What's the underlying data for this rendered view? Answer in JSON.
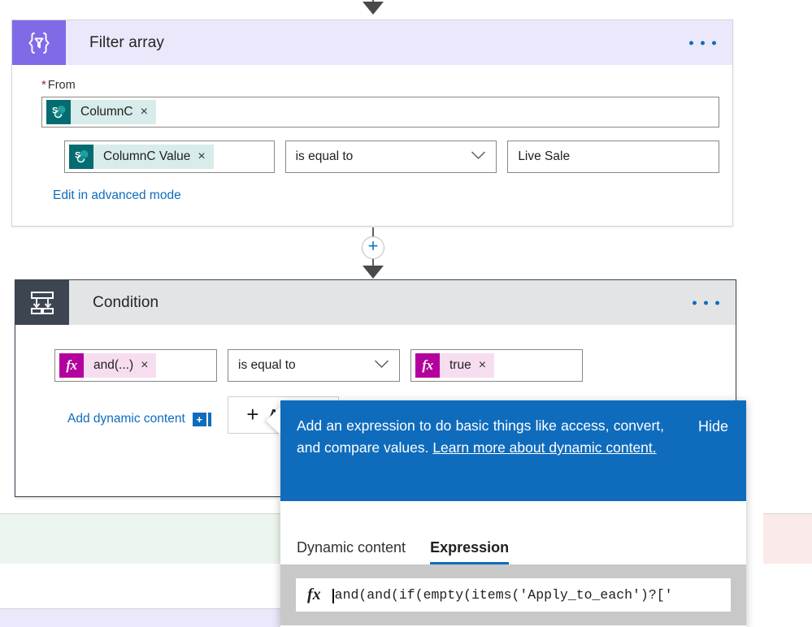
{
  "flow": {
    "top_connector": {
      "icon": "arrow-down-icon"
    },
    "between_connector": {
      "icon": "add-step-plus-icon",
      "symbol": "+"
    }
  },
  "filter_array_card": {
    "icon_name": "filter-array-icon",
    "title": "Filter array",
    "menu_label": "…",
    "from_label": "From",
    "required_marker": "*",
    "from_token": {
      "icon": "sharepoint-icon",
      "icon_letter": "S",
      "label": "ColumnC",
      "remove": "×"
    },
    "condition_row": {
      "left_token": {
        "icon": "sharepoint-icon",
        "icon_letter": "S",
        "label": "ColumnC Value",
        "remove": "×"
      },
      "operator": "is equal to",
      "operator_chevron": "⌄",
      "value": "Live Sale"
    },
    "advanced_link": "Edit in advanced mode"
  },
  "condition_card": {
    "icon_name": "condition-branch-icon",
    "title": "Condition",
    "menu_label": "…",
    "row": {
      "left_token": {
        "icon": "expression-fx-icon",
        "icon_label": "fx",
        "label": "and(...)",
        "remove": "×"
      },
      "operator": "is equal to",
      "operator_chevron": "⌄",
      "right_token": {
        "icon": "expression-fx-icon",
        "icon_label": "fx",
        "label": "true",
        "remove": "×"
      }
    },
    "add_dynamic_content": "Add dynamic content",
    "add_dynamic_icon": "+",
    "add_button": {
      "plus": "+",
      "label": "Add",
      "chevron": "⌄"
    }
  },
  "expression_flyout": {
    "banner": {
      "text_before_link": "Add an expression to do basic things like access, convert, and compare values. ",
      "link_text": "Learn more about dynamic content.",
      "hide_label": "Hide"
    },
    "tabs": [
      {
        "label": "Dynamic content",
        "active": false
      },
      {
        "label": "Expression",
        "active": true
      }
    ],
    "input": {
      "fx_label": "fx",
      "value": "and(and(if(empty(items('Apply_to_each')?['"
    }
  },
  "branches": {
    "if_yes_color": "#ecf5ee",
    "if_no_color": "#fbeaea"
  },
  "colors": {
    "filter_accent": "#8269e8",
    "condition_accent": "#3d4551",
    "sharepoint_teal": "#036c70",
    "expression_magenta": "#b4009e",
    "link_blue": "#0f6cbd"
  }
}
